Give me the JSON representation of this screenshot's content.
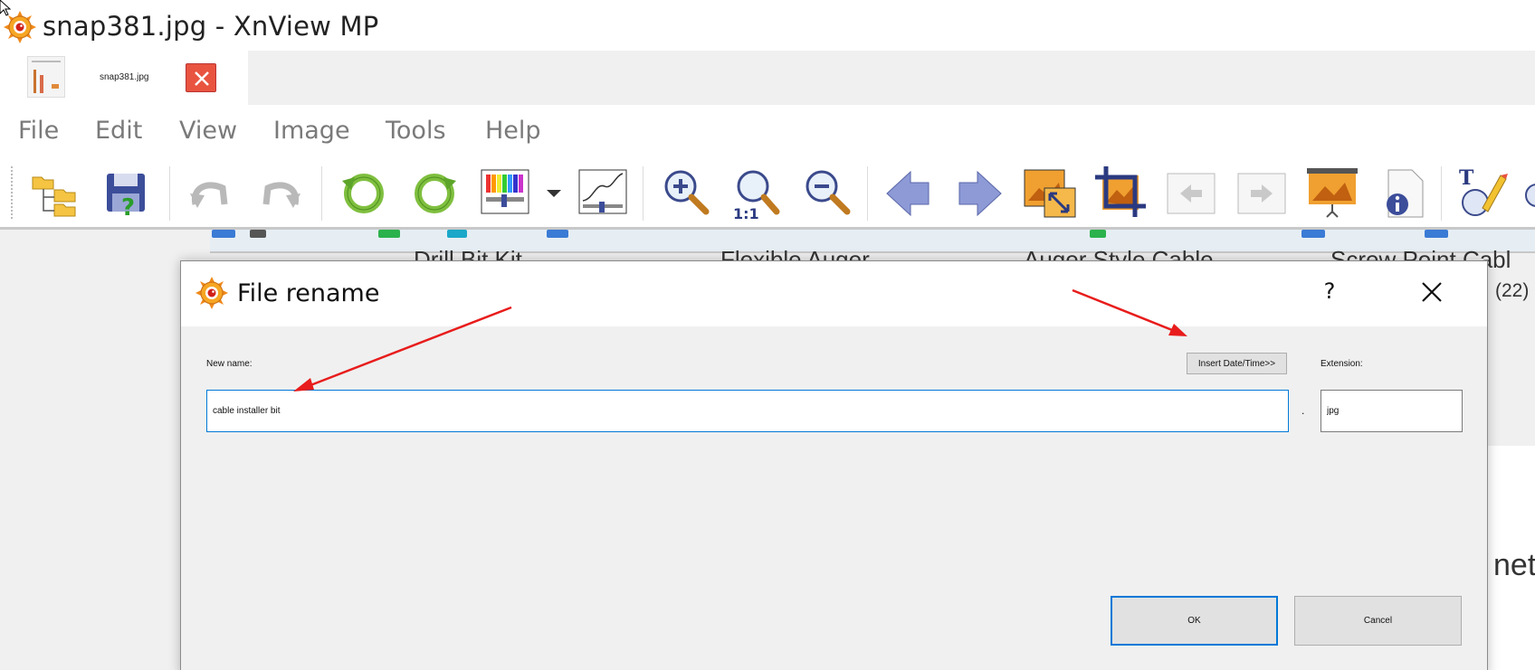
{
  "window": {
    "title": "snap381.jpg - XnView MP",
    "icon": "xnview-eye-icon"
  },
  "tabs": [
    {
      "label": "snap381.jpg",
      "icon": "thumbnail",
      "close_icon": "close-icon"
    }
  ],
  "menu": {
    "items": [
      "File",
      "Edit",
      "View",
      "Image",
      "Tools",
      "Help"
    ]
  },
  "toolbar": {
    "icons": [
      "browser-folders-icon",
      "save-help-icon",
      "undo-icon",
      "redo-icon",
      "rotate-left-icon",
      "rotate-right-icon",
      "color-adjust-icon",
      "dropdown-arrow-icon",
      "curves-icon",
      "zoom-in-icon",
      "zoom-1to1-icon",
      "zoom-out-icon",
      "previous-arrow-icon",
      "next-arrow-icon",
      "resize-image-icon",
      "crop-icon",
      "previous-page-icon",
      "next-page-icon",
      "slideshow-icon",
      "file-info-icon",
      "text-edit-icon"
    ]
  },
  "background": {
    "product_labels": [
      "Drill Bit Kit",
      "Flexible Auger",
      "Auger Style Cable",
      "Screw Point Cabl"
    ],
    "count": "(22)",
    "partial_text": "nete"
  },
  "dialog": {
    "title": "File rename",
    "help_label": "?",
    "new_name_label": "New name:",
    "insert_button": "Insert Date/Time>>",
    "extension_label": "Extension:",
    "name_value": "cable installer bit",
    "dot": ".",
    "extension_value": "jpg",
    "ok_label": "OK",
    "cancel_label": "Cancel"
  },
  "colors": {
    "accent": "#0078d7",
    "annotation_arrow": "#e81c1c",
    "close_tab": "#e8543f",
    "menu_text": "#7a7a7a"
  }
}
